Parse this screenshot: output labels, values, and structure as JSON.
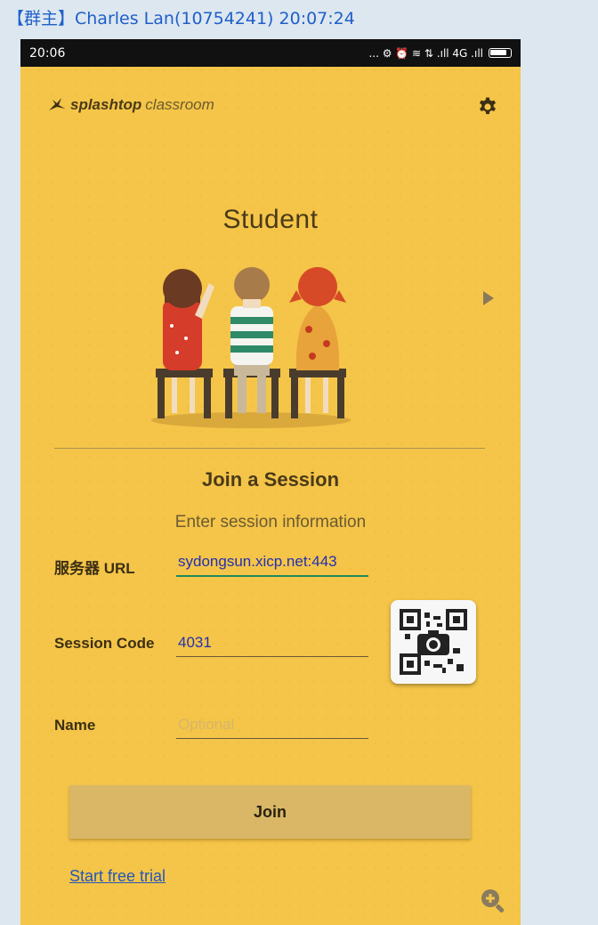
{
  "chat": {
    "header": "【群主】Charles Lan(10754241) 20:07:24"
  },
  "statusbar": {
    "time": "20:06",
    "icons": "... ⚙ ⏰ ≋ ⇅ .ıll 4G .ıll"
  },
  "app": {
    "brand": "splashtop",
    "product": "classroom",
    "role_title": "Student",
    "section_title": "Join a Session",
    "subtitle": "Enter session information"
  },
  "form": {
    "server_label": "服务器 URL",
    "server_value": "sydongsun.xicp.net:443",
    "code_label": "Session Code",
    "code_value": "4031",
    "name_label": "Name",
    "name_placeholder": "Optional",
    "name_value": ""
  },
  "buttons": {
    "join": "Join",
    "trial": "Start free trial"
  },
  "icons": [
    "settings-gear-icon",
    "next-arrow-icon",
    "qr-scan-icon",
    "zoom-in-icon",
    "splashtop-logo-icon"
  ],
  "colors": {
    "background": "#f4c548",
    "accent_link": "#2457b8",
    "input_text": "#2430b0",
    "join_button": "#d9b767"
  }
}
